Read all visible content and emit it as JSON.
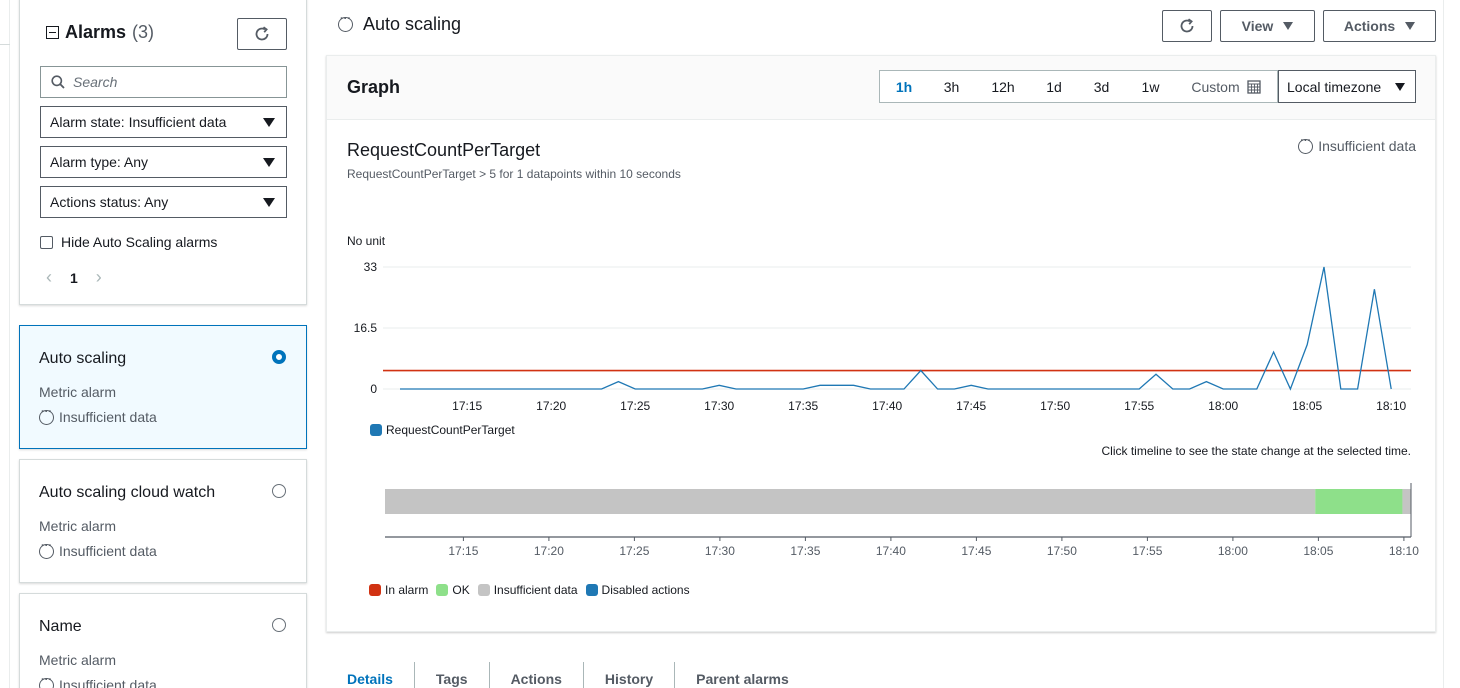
{
  "sidebar": {
    "title": "Alarms",
    "count": "(3)",
    "search_placeholder": "Search",
    "filters": [
      "Alarm state: Insufficient data",
      "Alarm type: Any",
      "Actions status: Any"
    ],
    "hide_autoscaling_label": "Hide Auto Scaling alarms",
    "page": "1",
    "alarms": [
      {
        "name": "Auto scaling",
        "type": "Metric alarm",
        "state": "Insufficient data",
        "selected": true
      },
      {
        "name": "Auto scaling cloud watch",
        "type": "Metric alarm",
        "state": "Insufficient data",
        "selected": false
      },
      {
        "name": "Name",
        "type": "Metric alarm",
        "state": "Insufficient data",
        "selected": false
      }
    ]
  },
  "main": {
    "title": "Auto scaling",
    "view_label": "View",
    "actions_label": "Actions",
    "graph_title": "Graph",
    "ranges": [
      "1h",
      "3h",
      "12h",
      "1d",
      "3d",
      "1w",
      "Custom"
    ],
    "active_range": "1h",
    "timezone": "Local timezone",
    "metric_name": "RequestCountPerTarget",
    "metric_desc": "RequestCountPerTarget > 5 for 1 datapoints within 10 seconds",
    "state": "Insufficient data",
    "timeline_hint": "Click timeline to see the state change at the selected time.",
    "tabs": [
      "Details",
      "Tags",
      "Actions",
      "History",
      "Parent alarms"
    ],
    "active_tab": "Details"
  },
  "chart_data": {
    "type": "line",
    "ylabel": "No unit",
    "yticks": [
      "33",
      "16.5",
      "0"
    ],
    "ylim": [
      0,
      33
    ],
    "threshold": 5,
    "threshold_color": "#d13212",
    "series_color": "#1f78b4",
    "series": [
      {
        "name": "RequestCountPerTarget",
        "values": [
          [
            0,
            0
          ],
          [
            1,
            0
          ],
          [
            3,
            0
          ],
          [
            12,
            0
          ],
          [
            13,
            2
          ],
          [
            14,
            0
          ],
          [
            18,
            0
          ],
          [
            19,
            1
          ],
          [
            20,
            0
          ],
          [
            24,
            0
          ],
          [
            25,
            1
          ],
          [
            27,
            1
          ],
          [
            28,
            0
          ],
          [
            30,
            0
          ],
          [
            31,
            5
          ],
          [
            32,
            0
          ],
          [
            33,
            0
          ],
          [
            34,
            1
          ],
          [
            35,
            0
          ],
          [
            44,
            0
          ],
          [
            45,
            4
          ],
          [
            46,
            0
          ],
          [
            47,
            0
          ],
          [
            48,
            2
          ],
          [
            49,
            0
          ],
          [
            51,
            0
          ],
          [
            52,
            10
          ],
          [
            53,
            0
          ],
          [
            54,
            12
          ],
          [
            55,
            33
          ],
          [
            56,
            0
          ],
          [
            57,
            0
          ],
          [
            58,
            27
          ],
          [
            59,
            0
          ]
        ]
      }
    ],
    "x_start": "17:11",
    "xticks": [
      "17:15",
      "17:20",
      "17:25",
      "17:30",
      "17:35",
      "17:40",
      "17:45",
      "17:50",
      "17:55",
      "18:00",
      "18:05",
      "18:10"
    ],
    "timeline": {
      "segments": [
        {
          "state": "Insufficient data",
          "from": 0,
          "to": 54.4
        },
        {
          "state": "OK",
          "from": 54.4,
          "to": 59.5
        },
        {
          "state": "Insufficient data",
          "from": 59.5,
          "to": 60
        }
      ]
    },
    "state_legend": [
      {
        "label": "In alarm",
        "color": "#d13212"
      },
      {
        "label": "OK",
        "color": "#8ee08a"
      },
      {
        "label": "Insufficient data",
        "color": "#c4c4c4"
      },
      {
        "label": "Disabled actions",
        "color": "#1f78b4"
      }
    ]
  }
}
